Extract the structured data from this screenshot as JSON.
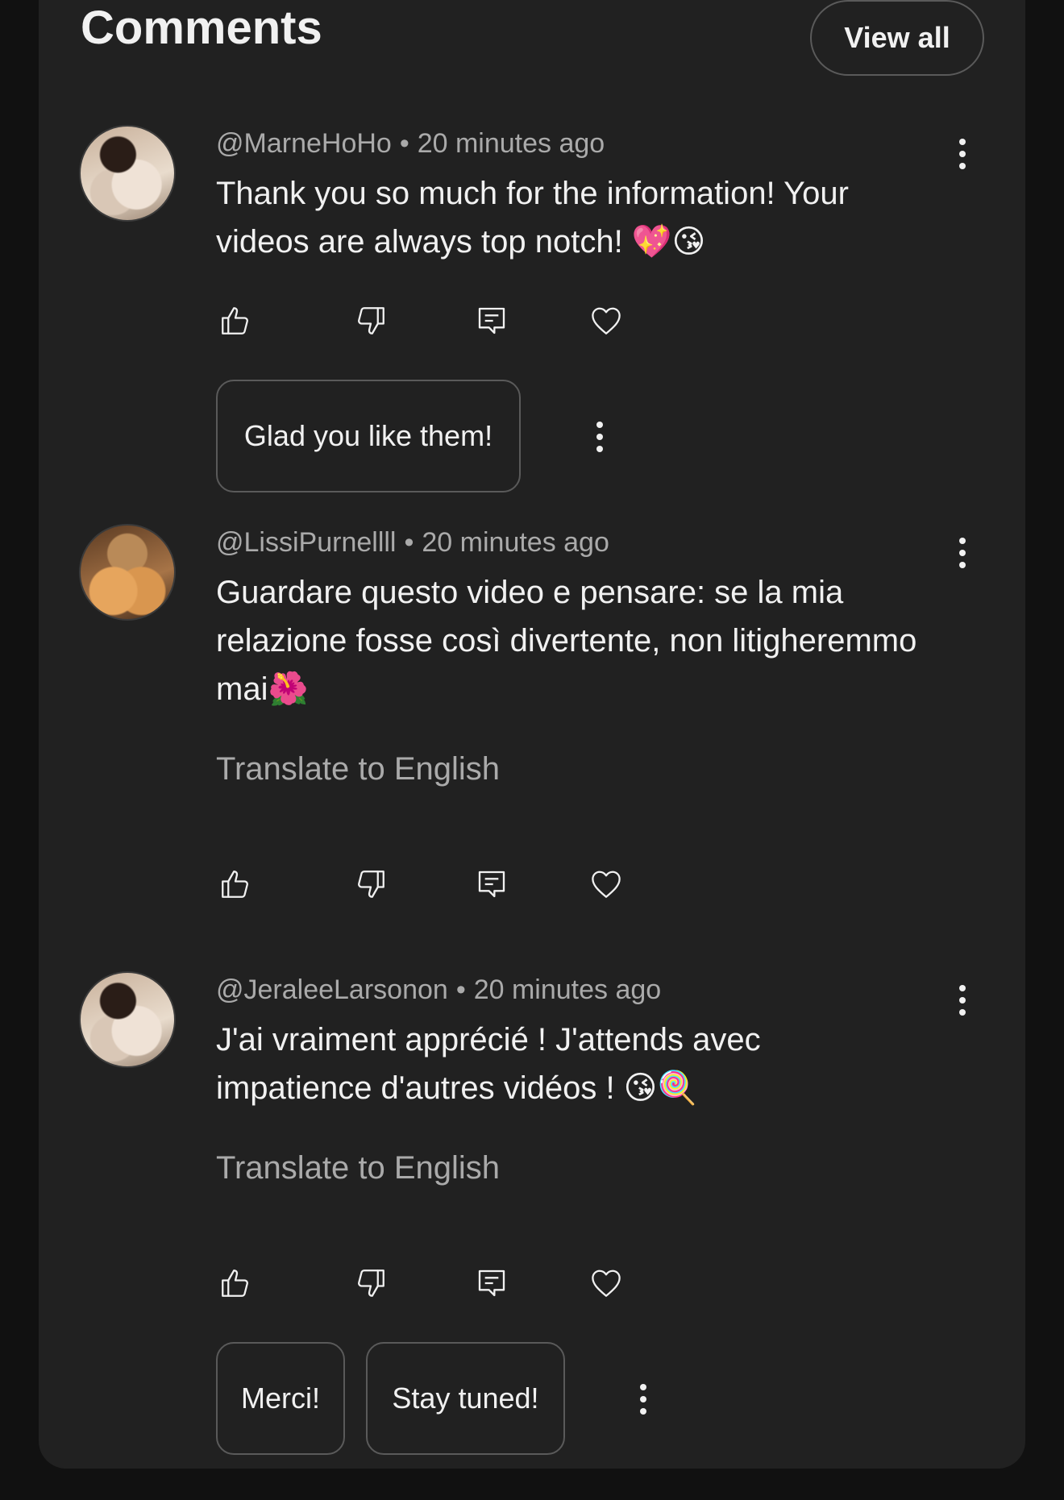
{
  "header": {
    "title": "Comments",
    "view_all_label": "View all"
  },
  "comments": [
    {
      "author": "@MarneHoHo",
      "time": "20 minutes ago",
      "text": "Thank you so much for the information! Your videos are always top notch! 💖😘",
      "translate_label": "",
      "replies": [
        "Glad you like them!"
      ]
    },
    {
      "author": "@LissiPurnellll",
      "time": "20 minutes ago",
      "text": "Guardare questo video e pensare: se la mia relazione fosse così divertente, non litigheremmo mai🌺",
      "translate_label": "Translate to English",
      "replies": []
    },
    {
      "author": "@JeraleeLarsonon",
      "time": "20 minutes ago",
      "text": "J'ai vraiment apprécié ! J'attends avec impatience d'autres vidéos ! 😘🍭",
      "translate_label": "Translate to English",
      "replies": [
        "Merci!",
        "Stay tuned!"
      ]
    }
  ],
  "meta_separator": "•",
  "icons": [
    "thumbs-up-icon",
    "thumbs-down-icon",
    "reply-icon",
    "heart-icon",
    "more-vert-icon"
  ],
  "colors": {
    "background": "#111111",
    "panel": "#212121",
    "text": "#f1f1f1",
    "secondary_text": "#aaaaaa",
    "border": "#5a5a5a"
  }
}
